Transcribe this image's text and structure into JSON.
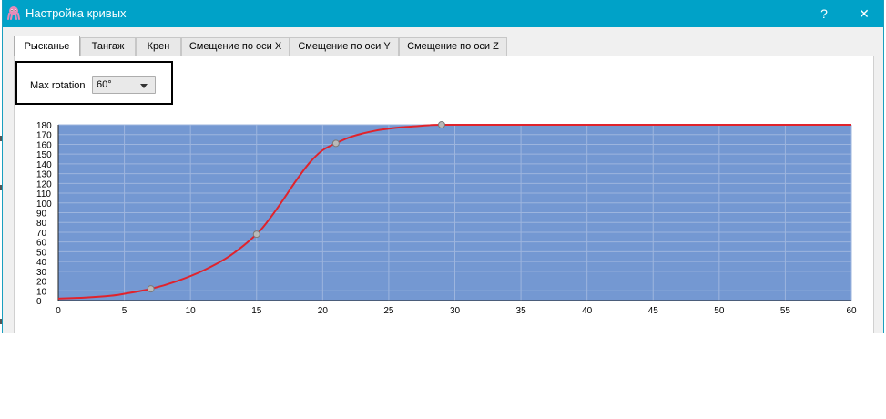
{
  "window": {
    "title": "Настройка кривых",
    "help_label": "?",
    "close_label": "✕"
  },
  "tabs": [
    {
      "label": "Рысканье",
      "active": true
    },
    {
      "label": "Тангаж",
      "active": false
    },
    {
      "label": "Крен",
      "active": false
    },
    {
      "label": "Смещение по оси X",
      "active": false
    },
    {
      "label": "Смещение по оси Y",
      "active": false
    },
    {
      "label": "Смещение по оси Z",
      "active": false
    }
  ],
  "max_rotation": {
    "label": "Max rotation",
    "value": "60°"
  },
  "colors": {
    "titlebar": "#00a2c8",
    "plot_bg": "#7498d2",
    "curve": "#e0232c"
  },
  "chart_data": {
    "type": "line",
    "title": "",
    "xlabel": "",
    "ylabel": "",
    "xlim": [
      0,
      60
    ],
    "ylim": [
      0,
      180
    ],
    "x_ticks": [
      0,
      5,
      10,
      15,
      20,
      25,
      30,
      35,
      40,
      45,
      50,
      55,
      60
    ],
    "y_ticks": [
      0,
      10,
      20,
      30,
      40,
      50,
      60,
      70,
      80,
      90,
      100,
      110,
      120,
      130,
      140,
      150,
      160,
      170,
      180
    ],
    "grid": true,
    "control_points": [
      {
        "x": 7,
        "y": 12
      },
      {
        "x": 15,
        "y": 68
      },
      {
        "x": 21,
        "y": 161
      },
      {
        "x": 29,
        "y": 180
      }
    ],
    "series": [
      {
        "x": [
          0,
          2,
          4,
          5,
          7,
          9,
          11,
          13,
          15,
          16,
          17,
          18,
          19,
          20,
          21,
          22,
          23,
          24,
          25,
          26,
          27,
          28,
          29,
          35,
          40,
          45,
          50,
          55,
          60
        ],
        "values": [
          2,
          3,
          5,
          7,
          12,
          20,
          31,
          46,
          68,
          84,
          103,
          123,
          141,
          154,
          161,
          167,
          171,
          174,
          176,
          177.5,
          178.5,
          179.5,
          180,
          180,
          180,
          180,
          180,
          180,
          180
        ]
      }
    ]
  }
}
